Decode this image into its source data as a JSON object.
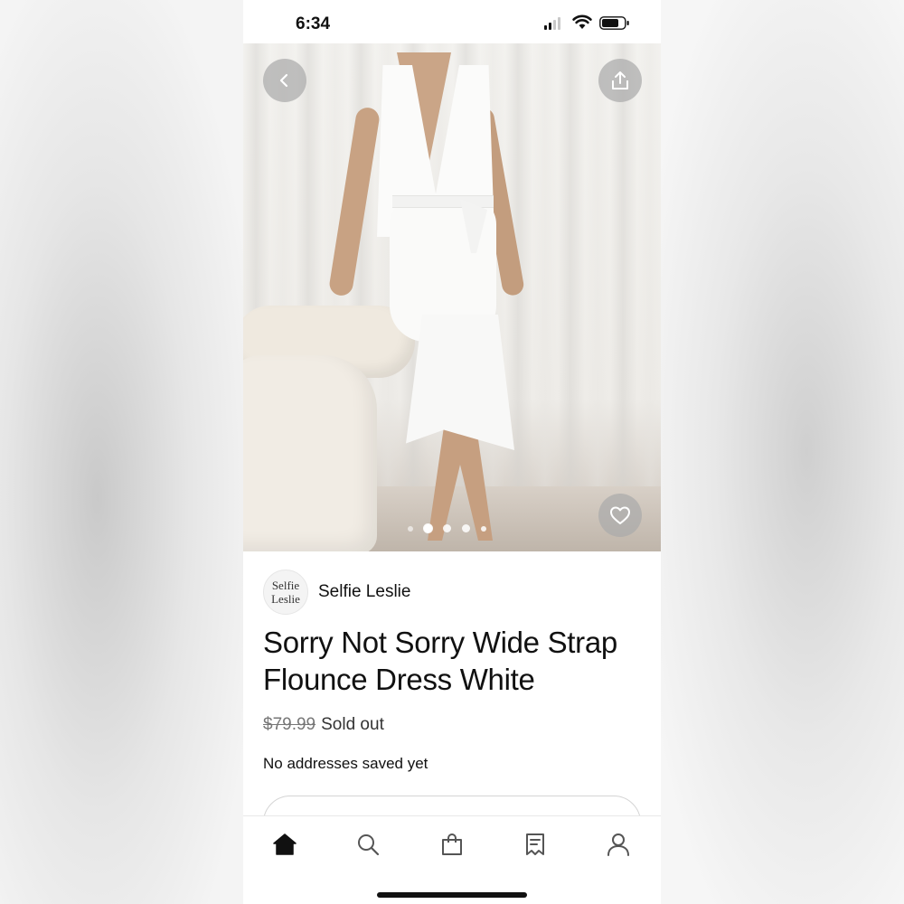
{
  "status_bar": {
    "time": "6:34"
  },
  "hero": {
    "image_alt": "Model wearing white flounce dress",
    "carousel_dot_count": 5,
    "active_dot_index": 1
  },
  "seller": {
    "logo_line1": "Selfie",
    "logo_line2": "Leslie",
    "name": "Selfie Leslie"
  },
  "product": {
    "title": "Sorry Not Sorry Wide Strap Flounce Dress White",
    "price": "$79.99",
    "availability": "Sold out",
    "address_note": "No addresses saved yet"
  },
  "tab_bar": {
    "tabs": [
      {
        "icon": "home-icon",
        "active": true
      },
      {
        "icon": "search-icon",
        "active": false
      },
      {
        "icon": "shopping-bag-icon",
        "active": false
      },
      {
        "icon": "receipt-icon",
        "active": false
      },
      {
        "icon": "profile-icon",
        "active": false
      }
    ]
  }
}
